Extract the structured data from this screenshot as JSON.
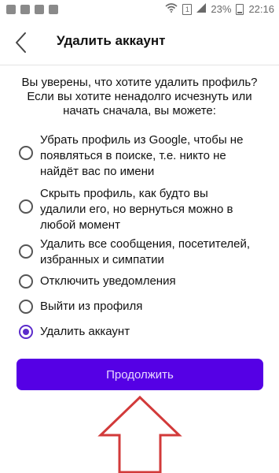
{
  "status_bar": {
    "battery_percent": "23%",
    "sim_label": "1",
    "time": "22:16"
  },
  "header": {
    "title": "Удалить аккаунт",
    "back_icon": "chevron-left-icon"
  },
  "intro": {
    "lines": [
      "Вы уверены, что хотите удалить профиль?",
      "Если вы хотите ненадолго исчезнуть или",
      "начать сначала, вы можете:"
    ]
  },
  "options": [
    {
      "lines": [
        "Убрать профиль из Google, чтобы не",
        "появляться в поиске, т.е. никто не",
        "найдёт вас по имени"
      ],
      "checked": false
    },
    {
      "lines": [
        "Скрыть профиль, как будто вы",
        "удалили его, но вернуться можно в",
        "любой момент"
      ],
      "checked": false
    },
    {
      "lines": [
        "Удалить все сообщения, посетителей,",
        "избранных и симпатии"
      ],
      "checked": false
    },
    {
      "lines": [
        "Отключить уведомления"
      ],
      "checked": false
    },
    {
      "lines": [
        "Выйти из профиля"
      ],
      "checked": false
    },
    {
      "lines": [
        "Удалить аккаунт"
      ],
      "checked": true
    }
  ],
  "continue_button": {
    "label": "Продолжить"
  },
  "colors": {
    "accent": "#5500e5",
    "radio_selected": "#5c2ccb",
    "arrow_outline": "#d23a3a"
  }
}
